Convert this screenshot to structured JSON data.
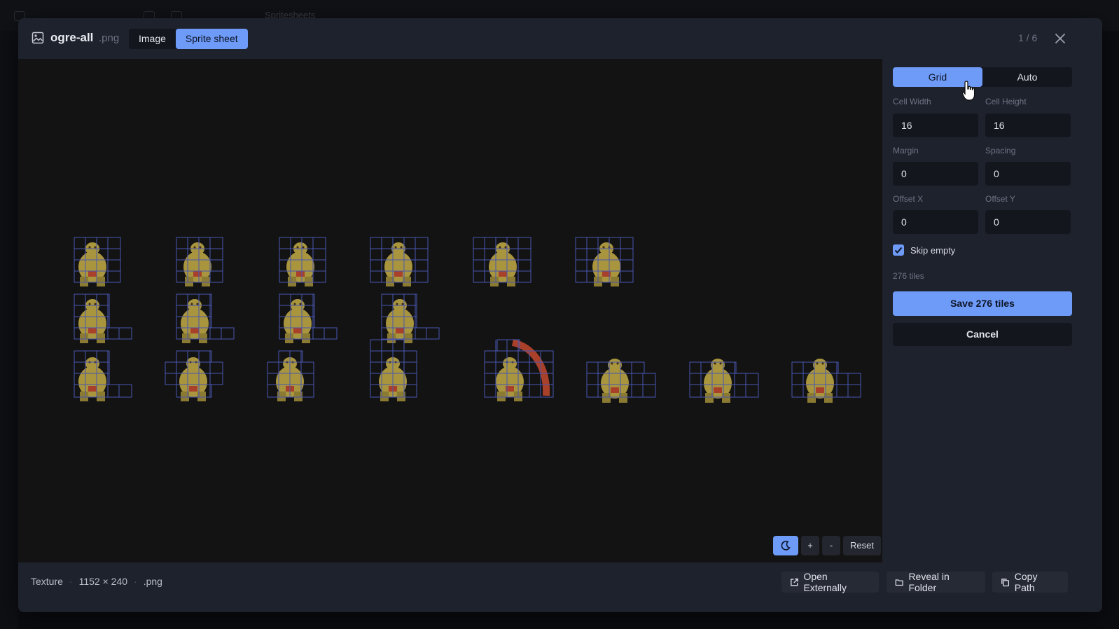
{
  "background": {
    "app_title": "Spritesheets"
  },
  "dialog": {
    "file_name": "ogre-all",
    "file_ext": ".png",
    "view_tabs": [
      {
        "label": "Image",
        "active": false
      },
      {
        "label": "Sprite sheet",
        "active": true
      }
    ],
    "counter": "1 / 6"
  },
  "viewer": {
    "zoom_plus": "+",
    "zoom_minus": "-",
    "zoom_reset": "Reset"
  },
  "settings": {
    "modes": [
      {
        "label": "Grid",
        "active": true
      },
      {
        "label": "Auto",
        "active": false
      }
    ],
    "cell_width": {
      "label": "Cell Width",
      "value": "16"
    },
    "cell_height": {
      "label": "Cell Height",
      "value": "16"
    },
    "margin": {
      "label": "Margin",
      "value": "0"
    },
    "spacing": {
      "label": "Spacing",
      "value": "0"
    },
    "offset_x": {
      "label": "Offset X",
      "value": "0"
    },
    "offset_y": {
      "label": "Offset Y",
      "value": "0"
    },
    "skip_empty": {
      "label": "Skip empty",
      "checked": true
    },
    "tile_count": "276 tiles",
    "save_label": "Save 276 tiles",
    "cancel_label": "Cancel"
  },
  "footer": {
    "type": "Texture",
    "dimensions": "1152 × 240",
    "ext": ".png",
    "open_externally": "Open Externally",
    "reveal_in_folder": "Reveal in Folder",
    "copy_path": "Copy Path"
  },
  "colors": {
    "accent": "#6e9af8",
    "grid_line": "#4a57b0",
    "sprite_body": "#a8953e",
    "sprite_accent": "#a8402a"
  }
}
